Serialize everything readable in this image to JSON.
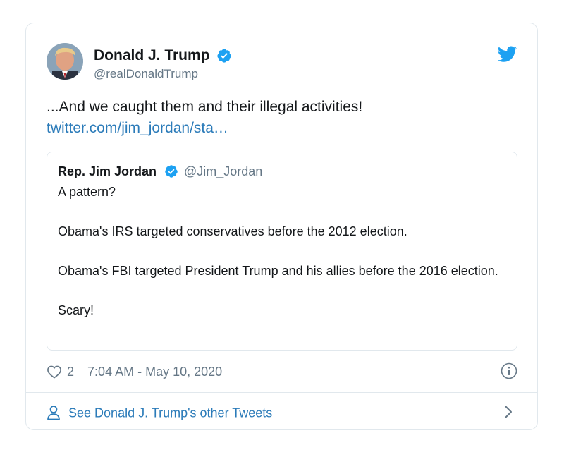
{
  "colors": {
    "link": "#2b7bb9",
    "verified": "#1da1f2",
    "secondary_text": "#657786",
    "border": "#e1e8ed"
  },
  "author": {
    "name": "Donald J. Trump",
    "handle": "@realDonaldTrump",
    "avatar_icon": "user-avatar",
    "verified_icon": "verified-badge-icon"
  },
  "brand_icon": "twitter-bird-icon",
  "tweet": {
    "text": "...And we caught them and their illegal activities!",
    "link_text": "twitter.com/jim_jordan/sta…"
  },
  "quoted_tweet": {
    "name": "Rep. Jim Jordan",
    "handle": "@Jim_Jordan",
    "body": "A pattern?\n\nObama's IRS targeted conservatives before the 2012 election.\n\nObama's FBI targeted President Trump and his allies before the 2016 election.\n\nScary!"
  },
  "meta": {
    "like_icon": "heart-icon",
    "like_count": "2",
    "timestamp": "7:04 AM - May 10, 2020",
    "info_icon": "info-icon"
  },
  "footer": {
    "icon": "person-icon",
    "label": "See Donald J. Trump's other Tweets",
    "chevron_icon": "chevron-right-icon"
  }
}
